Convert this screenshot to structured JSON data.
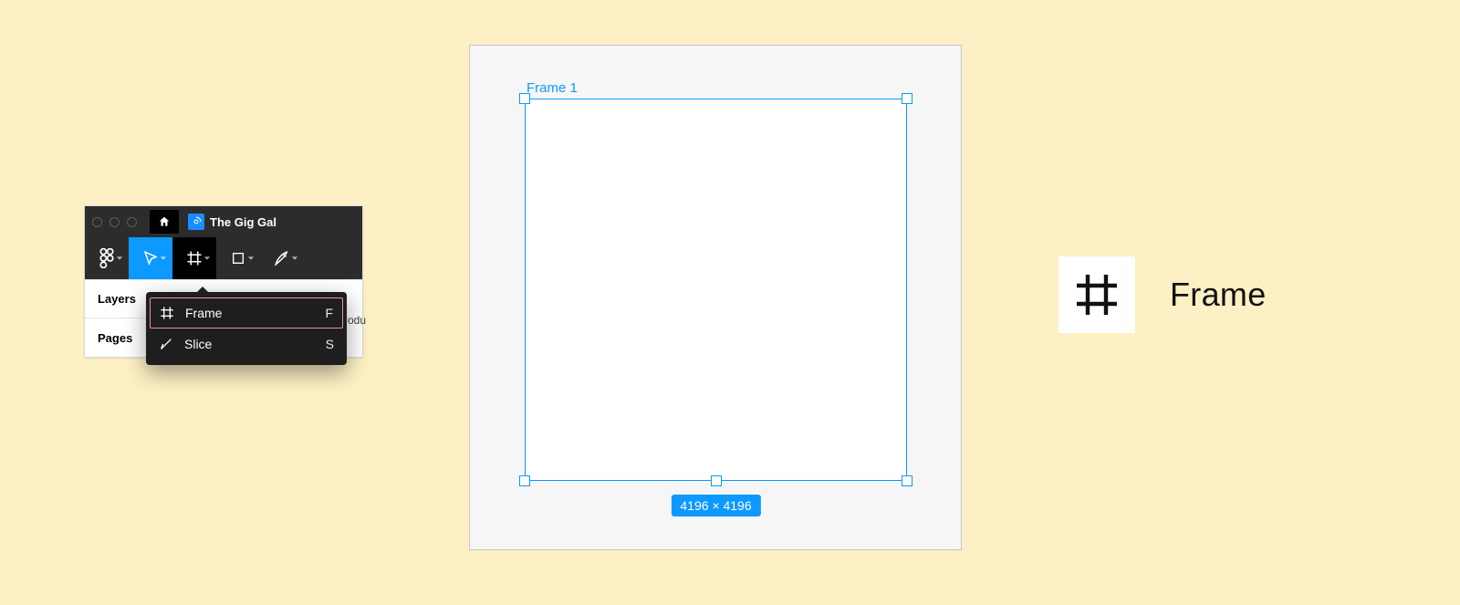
{
  "window": {
    "tab_title": "The Gig Gal",
    "panel_tabs": {
      "layers": "Layers",
      "pages": "Pages",
      "module_cut": "Modu"
    }
  },
  "dropdown": {
    "frame": {
      "label": "Frame",
      "shortcut": "F"
    },
    "slice": {
      "label": "Slice",
      "shortcut": "S"
    }
  },
  "canvas": {
    "frame_name": "Frame 1",
    "dimensions": "4196 × 4196"
  },
  "legend": {
    "label": "Frame"
  },
  "colors": {
    "accent": "#0d99ff",
    "page_bg": "#fcf0c4",
    "highlight_border": "#f28c99"
  }
}
